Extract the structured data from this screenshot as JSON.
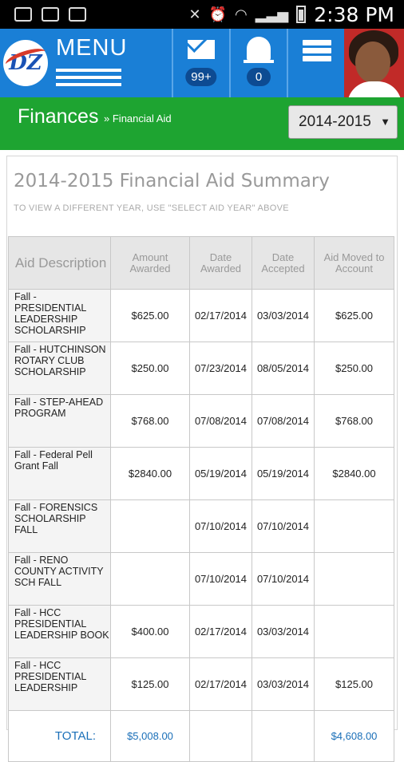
{
  "status_bar": {
    "time": "2:38 PM"
  },
  "header": {
    "logo_text": "DZ",
    "menu_label": "MENU",
    "messages_count": "99+",
    "notifications_count": "0"
  },
  "breadcrumb": {
    "title": "Finances",
    "separator": "»",
    "current": "Financial Aid"
  },
  "year_select": {
    "value": "2014-2015"
  },
  "summary": {
    "title": "2014-2015 Financial Aid Summary",
    "note": "TO VIEW A DIFFERENT YEAR, USE \"SELECT AID YEAR\" ABOVE"
  },
  "table": {
    "headers": [
      "Aid Description",
      "Amount Awarded",
      "Date Awarded",
      "Date Accepted",
      "Aid Moved to Account"
    ],
    "rows": [
      [
        "Fall - PRESIDENTIAL LEADERSHIP SCHOLARSHIP",
        "$625.00",
        "02/17/2014",
        "03/03/2014",
        "$625.00"
      ],
      [
        "Fall - HUTCHINSON ROTARY CLUB SCHOLARSHIP",
        "$250.00",
        "07/23/2014",
        "08/05/2014",
        "$250.00"
      ],
      [
        "Fall - STEP-AHEAD PROGRAM",
        "$768.00",
        "07/08/2014",
        "07/08/2014",
        "$768.00"
      ],
      [
        "Fall - Federal Pell Grant Fall",
        "$2840.00",
        "05/19/2014",
        "05/19/2014",
        "$2840.00"
      ],
      [
        "Fall - FORENSICS SCHOLARSHIP FALL",
        "",
        "07/10/2014",
        "07/10/2014",
        ""
      ],
      [
        "Fall - RENO COUNTY ACTIVITY SCH FALL",
        "",
        "07/10/2014",
        "07/10/2014",
        ""
      ],
      [
        "Fall - HCC PRESIDENTIAL LEADERSHIP BOOK",
        "$400.00",
        "02/17/2014",
        "03/03/2014",
        ""
      ],
      [
        "Fall - HCC PRESIDENTIAL LEADERSHIP",
        "$125.00",
        "02/17/2014",
        "03/03/2014",
        "$125.00"
      ]
    ],
    "total": {
      "label": "TOTAL:",
      "amount_awarded": "$5,008.00",
      "aid_moved": "$4,608.00"
    }
  }
}
